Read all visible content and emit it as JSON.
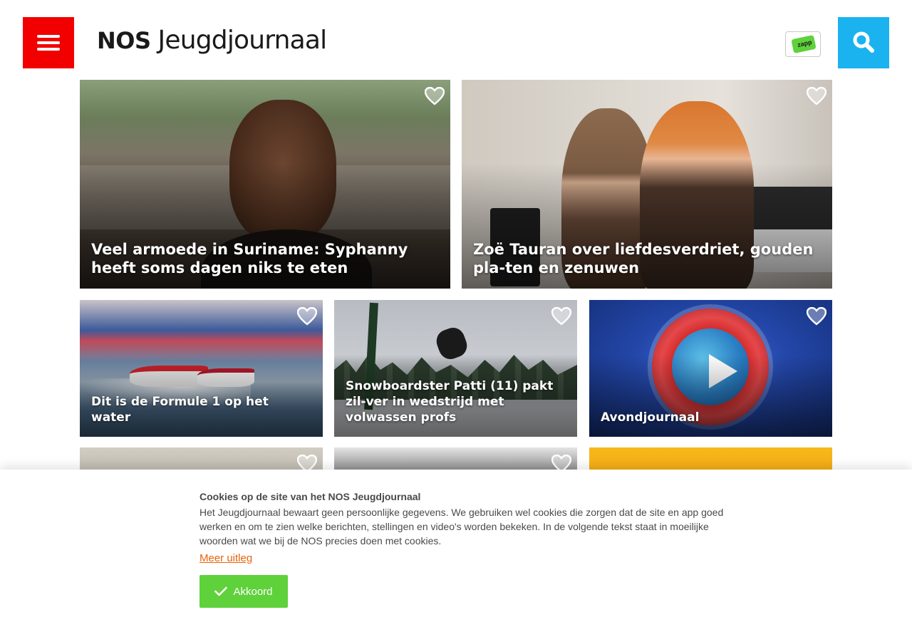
{
  "header": {
    "logo_brand": "NOS",
    "logo_name": "Jeugdjournaal",
    "zapp_label": "zapp",
    "menu_icon": "hamburger-menu-icon",
    "search_icon": "search-icon",
    "colors": {
      "menu_bg": "#f20000",
      "search_bg": "#1ab3f0",
      "zapp_green": "#5fd13b"
    }
  },
  "articles": [
    {
      "title": "Veel armoede in Suriname: Syphanny heeft soms dagen niks te eten"
    },
    {
      "title": "Zoë Tauran over liefdesverdriet, gouden pla-ten en zenuwen"
    },
    {
      "title": "Dit is de Formule 1 op het water"
    },
    {
      "title": "Snowboardster Patti (11) pakt zil-ver in wedstrijd met volwassen profs"
    },
    {
      "title": "Avondjournaal"
    }
  ],
  "cookie_banner": {
    "title": "Cookies op de site van het NOS Jeugdjournaal",
    "text": "Het Jeugdjournaal bewaart geen persoonlijke gegevens. We gebruiken wel cookies die zorgen dat de site en app goed werken en om te zien welke berichten, stellingen en video's worden bekeken. In de volgende tekst staat in moeilijke woorden wat we bij de NOS precies doen met cookies.",
    "more_link": "Meer uitleg",
    "accept_label": "Akkoord",
    "colors": {
      "link": "#e8630a",
      "accept_bg": "#5fd13b"
    }
  }
}
